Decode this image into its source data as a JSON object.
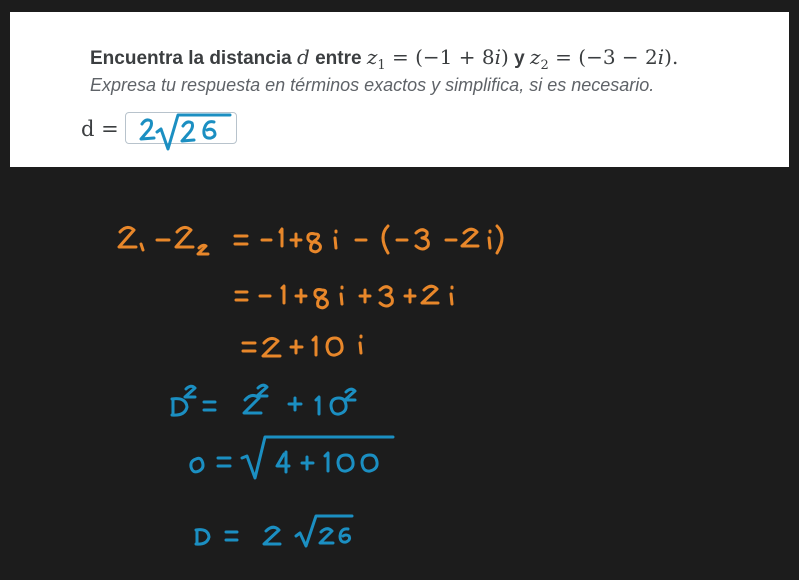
{
  "question": {
    "prefix": "Encuentra la distancia",
    "d_var": "d",
    "between": "entre",
    "z1_label": "z",
    "z1_sub": "1",
    "equals1": " = (−1 + 8",
    "i1": "i",
    "close1": ")",
    "and": "y",
    "z2_label": "z",
    "z2_sub": "2",
    "equals2": " = (−3 − 2",
    "i2": "i",
    "close2": ").",
    "instruction": "Expresa tu respuesta en términos exactos y simplifica, si es necesario."
  },
  "answer": {
    "label": "d =",
    "handwritten_value": "2√26"
  },
  "work_lines": [
    "z₁ − z₂ = −1+8i − (−3 −2i)",
    "= − 1+8i +3 +2i",
    "= 2 +10i",
    "D² = 2² + 10²",
    "D = √(4 + 100)",
    "D = 2 √26"
  ],
  "colors": {
    "orange": "#e8872a",
    "blue": "#1b8fc2",
    "background": "#1c1c1c",
    "card": "#ffffff"
  }
}
